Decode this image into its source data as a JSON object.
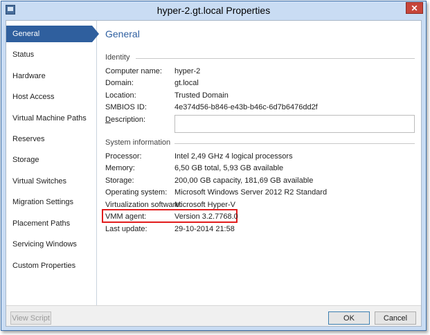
{
  "window": {
    "title": "hyper-2.gt.local Properties",
    "close_label": "✕"
  },
  "sidebar": {
    "items": [
      {
        "label": "General",
        "active": true
      },
      {
        "label": "Status"
      },
      {
        "label": "Hardware"
      },
      {
        "label": "Host Access"
      },
      {
        "label": "Virtual Machine Paths"
      },
      {
        "label": "Reserves"
      },
      {
        "label": "Storage"
      },
      {
        "label": "Virtual Switches"
      },
      {
        "label": "Migration Settings"
      },
      {
        "label": "Placement Paths"
      },
      {
        "label": "Servicing Windows"
      },
      {
        "label": "Custom Properties"
      }
    ]
  },
  "main": {
    "heading": "General",
    "identity": {
      "group_label": "Identity",
      "computer_name_label": "Computer name:",
      "computer_name": "hyper-2",
      "domain_label": "Domain:",
      "domain": "gt.local",
      "location_label": "Location:",
      "location": "Trusted Domain",
      "smbios_label": "SMBIOS ID:",
      "smbios": "4e374d56-b846-e43b-b46c-6d7b6476dd2f",
      "description_label_u": "D",
      "description_label_rest": "escription:",
      "description_value": ""
    },
    "system": {
      "group_label": "System information",
      "processor_label": "Processor:",
      "processor": "Intel  2,49 GHz 4 logical processors",
      "memory_label": "Memory:",
      "memory": "6,50 GB total, 5,93 GB available",
      "storage_label": "Storage:",
      "storage": "200,00 GB capacity, 181,69 GB available",
      "os_label": "Operating system:",
      "os": "Microsoft Windows Server 2012 R2 Standard",
      "virt_label": "Virtualization software:",
      "virt": "Microsoft Hyper-V",
      "vmm_label": "VMM agent:",
      "vmm": "Version 3.2.7768.0",
      "last_update_label": "Last update:",
      "last_update": "29-10-2014 21:58"
    }
  },
  "footer": {
    "view_script_label": "View Script",
    "ok_label": "OK",
    "cancel_label": "Cancel"
  },
  "colors": {
    "accent": "#2f5f9e",
    "heading": "#2e5fa0",
    "highlight": "#e21c1c",
    "titlebar": "#c9dcf3"
  }
}
